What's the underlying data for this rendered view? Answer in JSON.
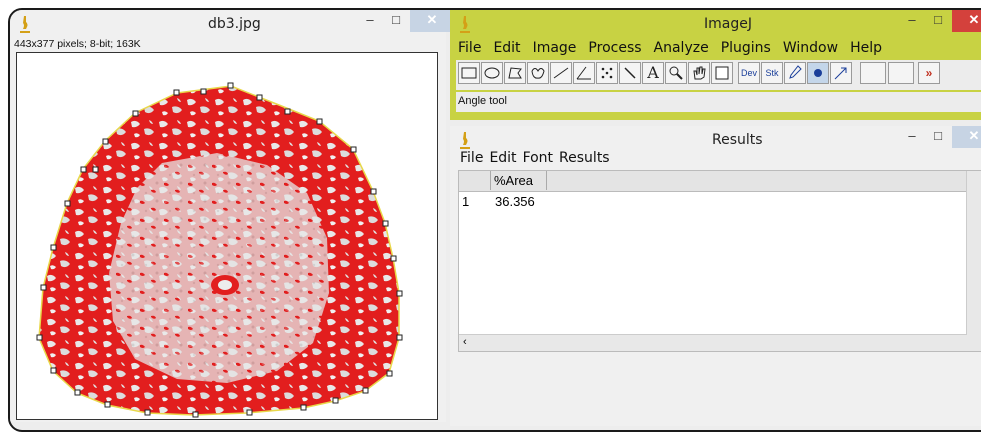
{
  "image_window": {
    "title": "db3.jpg",
    "info": "443x377 pixels; 8-bit; 163K",
    "minimize": "–",
    "maximize": "□",
    "close": "✕"
  },
  "imagej_window": {
    "title": "ImageJ",
    "menu": [
      "File",
      "Edit",
      "Image",
      "Process",
      "Analyze",
      "Plugins",
      "Window",
      "Help"
    ],
    "tools": [
      "rectangle",
      "oval",
      "polygon",
      "freehand",
      "line",
      "angle",
      "multipoint",
      "wand",
      "text",
      "magnifier",
      "hand",
      "color-picker",
      "Dev",
      "Stk",
      "brush",
      "arrow",
      "pencil",
      "blank",
      "blank",
      "more"
    ],
    "dev_label": "Dev",
    "stk_label": "Stk",
    "more_label": "»",
    "status": "Angle tool",
    "minimize": "–",
    "maximize": "□",
    "close": "✕"
  },
  "results_window": {
    "title": "Results",
    "menu": [
      "File",
      "Edit",
      "Font",
      "Results"
    ],
    "columns": [
      "",
      "%Area"
    ],
    "rows": [
      {
        "index": "1",
        "value": "36.356"
      }
    ],
    "minimize": "–",
    "maximize": "□",
    "close": "✕"
  },
  "colors": {
    "imagej_title": "#c8d243",
    "region_fill": "#e21e1e",
    "roi_outline": "#e8d84a"
  }
}
